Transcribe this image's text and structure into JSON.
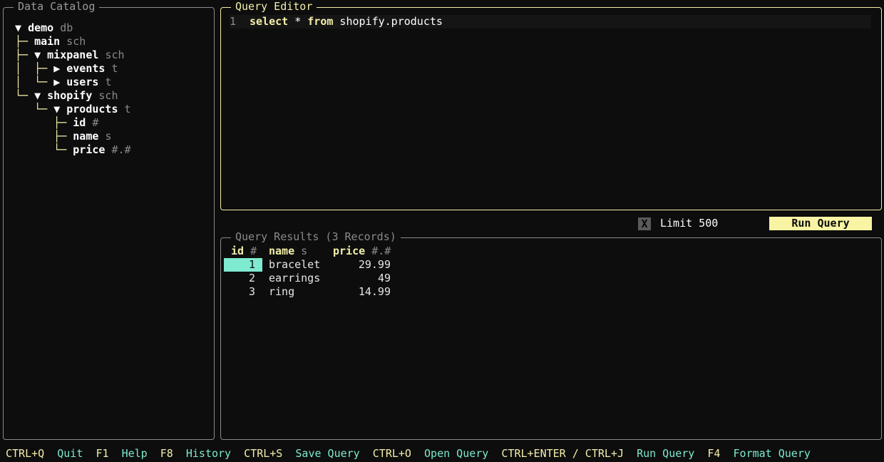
{
  "catalog": {
    "title": "Data Catalog",
    "tree": [
      {
        "prefix": "",
        "arrow": "▼ ",
        "name": "demo",
        "type": "db"
      },
      {
        "prefix": "├─ ",
        "arrow": "",
        "name": "main",
        "type": "sch"
      },
      {
        "prefix": "├─ ",
        "arrow": "▼ ",
        "name": "mixpanel",
        "type": "sch"
      },
      {
        "prefix": "│  ├─ ",
        "arrow": "▶ ",
        "name": "events",
        "type": "t"
      },
      {
        "prefix": "│  └─ ",
        "arrow": "▶ ",
        "name": "users",
        "type": "t"
      },
      {
        "prefix": "└─ ",
        "arrow": "▼ ",
        "name": "shopify",
        "type": "sch"
      },
      {
        "prefix": "   └─ ",
        "arrow": "▼ ",
        "name": "products",
        "type": "t"
      },
      {
        "prefix": "      ├─ ",
        "arrow": "",
        "name": "id",
        "type": "#"
      },
      {
        "prefix": "      ├─ ",
        "arrow": "",
        "name": "name",
        "type": "s"
      },
      {
        "prefix": "      └─ ",
        "arrow": "",
        "name": "price",
        "type": "#.#"
      }
    ]
  },
  "editor": {
    "title": "Query Editor",
    "line_number": "1",
    "kw1": "select",
    "star": " * ",
    "kw2": "from",
    "target": " shopify.products"
  },
  "controls": {
    "limit_check": "X",
    "limit_label": "Limit 500",
    "run_button": "Run Query"
  },
  "results": {
    "title": "Query Results (3 Records)",
    "columns": [
      {
        "name": "id",
        "type": "#"
      },
      {
        "name": "name",
        "type": "s"
      },
      {
        "name": "price",
        "type": "#.#"
      }
    ],
    "rows": [
      {
        "id": "1",
        "name": "bracelet",
        "price": "29.99",
        "selected": true
      },
      {
        "id": "2",
        "name": "earrings",
        "price": "49",
        "selected": false
      },
      {
        "id": "3",
        "name": "ring",
        "price": "14.99",
        "selected": false
      }
    ]
  },
  "footer": [
    {
      "key": "CTRL+Q",
      "action": "Quit"
    },
    {
      "key": "F1",
      "action": "Help"
    },
    {
      "key": "F8",
      "action": "History"
    },
    {
      "key": "CTRL+S",
      "action": "Save Query"
    },
    {
      "key": "CTRL+O",
      "action": "Open Query"
    },
    {
      "key": "CTRL+ENTER / CTRL+J",
      "action": "Run Query"
    },
    {
      "key": "F4",
      "action": "Format Query"
    }
  ]
}
